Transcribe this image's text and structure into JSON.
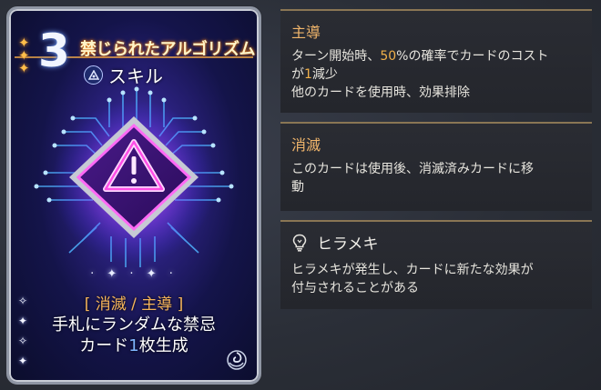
{
  "card": {
    "cost": "3",
    "title": "禁じられたアルゴリズム",
    "type_label": "スキル",
    "type_icon": "skill-triangle-icon",
    "tags": "[ 消滅 / 主導 ]",
    "desc_line1": "手札にランダムな禁忌",
    "desc_line2_pre": "カード",
    "desc_line2_num": "1",
    "desc_line2_post": "枚生成",
    "center_art": "warning-chip-icon",
    "corner_icon": "spiral-emblem-icon"
  },
  "panels": {
    "lead": {
      "title": "主導",
      "line1_pre": "ターン開始時、",
      "line1_num": "50",
      "line1_post": "%の確率でカードのコスト",
      "line2_pre": "が",
      "line2_num": "1",
      "line2_post": "減少",
      "line3": "他のカードを使用時、効果排除"
    },
    "exhaust": {
      "title": "消滅",
      "line1": "このカードは使用後、消滅済みカードに移",
      "line2": "動"
    },
    "inspiration": {
      "icon": "lightbulb-icon",
      "title": "ヒラメキ",
      "line1": "ヒラメキが発生し、カードに新たな効果が",
      "line2": "付与されることがある"
    }
  },
  "colors": {
    "accent_gold": "#f0b56b",
    "number_highlight": "#f0b04a",
    "card_blue_number": "#7fb7ff"
  }
}
